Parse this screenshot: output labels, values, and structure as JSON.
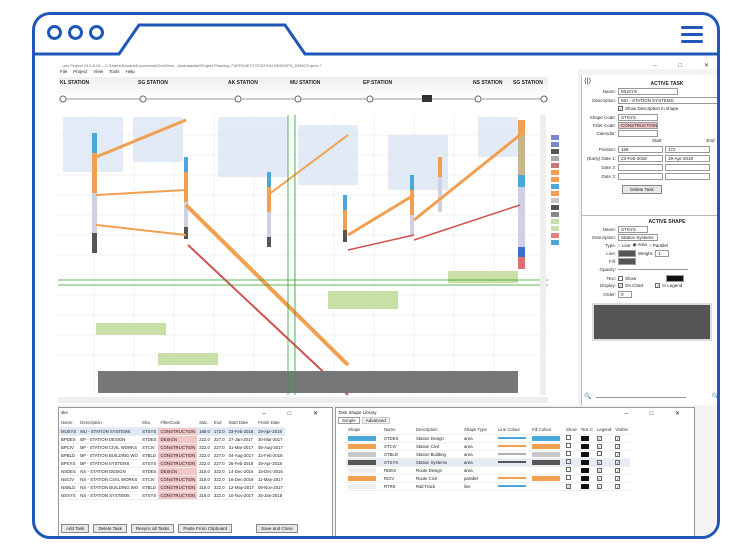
{
  "window": {
    "title": "...ear Project v3.0.8.15 -- C:\\Users\\Sandra\\Documents\\OneDrive - Australasian\\Project Planning 71\\PROJECT\\STATION DEMO\\PS_DEMO3.tpmz *",
    "menus": [
      "File",
      "Project",
      "View",
      "Tools",
      "Help"
    ]
  },
  "stations": [
    "KL STATION",
    "SG STATION",
    "AK STATION",
    "MU STATION",
    "EP STATION",
    "NS STATION",
    "SG STATION"
  ],
  "legend_items": [
    "",
    "",
    "",
    "",
    "",
    "",
    "",
    "",
    "",
    "",
    "",
    "",
    "",
    "",
    "",
    ""
  ],
  "active_task": {
    "title": "ACTIVE TASK",
    "name_label": "Name:",
    "name": "MUSYS",
    "desc_label": "Description:",
    "desc": "MU - STATION SYSTEMS",
    "show_desc": "Show Description in shape",
    "shape_code_label": "Shape Code:",
    "shape_code": "STSYS",
    "filter_code_label": "Filter Code:",
    "filter_code": "CONSTRUCTION",
    "calendar_label": "Calendar:",
    "start_label": "Start",
    "end_label": "End",
    "position_label": "Position:",
    "position_start": "168",
    "position_end": "172",
    "early_date_label": "(Early) Date 1:",
    "date1_start": "23-Feb-2018",
    "date1_end": "19-Apr-2018",
    "date2_label": "Date 2:",
    "date3_label": "Date 3:",
    "delete_btn": "Delete Task"
  },
  "active_shape": {
    "title": "ACTIVE SHAPE",
    "name_label": "Name:",
    "name": "STSYS",
    "desc_label": "Description:",
    "desc": "Station Systems",
    "type_label": "Type:",
    "type_line": "Line",
    "type_area": "Area",
    "type_parallel": "Parallel",
    "line_label": "Line:",
    "weight_label": "Weight:",
    "weight": "1",
    "fill_label": "Fill:",
    "opacity_label": "Opacity:",
    "text_label": "Text:",
    "show_label": "Show",
    "display_label": "Display:",
    "on_chart": "On Chart",
    "in_legend": "In Legend",
    "order_label": "Order:",
    "order": "0"
  },
  "tasks_window": {
    "title": "sks",
    "columns": [
      "Name",
      "Description",
      "Sha.",
      "FilterCode",
      "Star.",
      "End",
      "Start Date",
      "Finish Date"
    ],
    "rows": [
      [
        "MUSYS",
        "MU - STATION SYSTEMS",
        "STSYS",
        "CONSTRUCTION",
        "168.0",
        "172.0",
        "23-Feb-2018",
        "19-Apr-2018"
      ],
      [
        "BPDES",
        "BP - STATION DESIGN",
        "STDES",
        "DESIGN",
        "222.0",
        "227.0",
        "27-Jan-2017",
        "30-Mar-2017"
      ],
      [
        "BPCIV",
        "BP - STATION CIVIL WORKS",
        "STCIV",
        "CONSTRUCTION",
        "222.0",
        "227.0",
        "31-Mar-2017",
        "05-Aug-2017"
      ],
      [
        "BPBLD",
        "BP - STATION BUILDING WO",
        "STBLD",
        "CONSTRUCTION",
        "222.0",
        "227.0",
        "04-Aug-2017",
        "22-Feb-2018"
      ],
      [
        "BPSYS",
        "BP - STATION SYSTEMS",
        "STSYS",
        "CONSTRUCTION",
        "222.0",
        "227.0",
        "26-Feb-2018",
        "19-Apr-2018"
      ],
      [
        "NSDES",
        "NS - STATION DESIGN",
        "STDES",
        "DESIGN",
        "318.0",
        "322.0",
        "14-Dec-2016",
        "15-Dec-2016"
      ],
      [
        "NSCIV",
        "NS - STATION CIVIL WORKS",
        "STCIV",
        "CONSTRUCTION",
        "318.0",
        "322.0",
        "16-Dec-2016",
        "11-May-2017"
      ],
      [
        "NSBLD",
        "NS - STATION BUILDING WO",
        "STBLD",
        "CONSTRUCTION",
        "318.0",
        "322.0",
        "12-May-2017",
        "09-Nov-2017"
      ],
      [
        "NSSYS",
        "NS - STATION SYSTEMS",
        "STSYS",
        "CONSTRUCTION",
        "318.0",
        "322.0",
        "10-Nov-2017",
        "25-Jan-2018"
      ]
    ],
    "buttons": [
      "Add Task",
      "Delete Task",
      "Resync all Tasks",
      "Paste From Clipboard",
      "Save and Close"
    ]
  },
  "library_window": {
    "title": "Task Shape Library",
    "tabs": [
      "Simple",
      "Advanced"
    ],
    "columns": [
      "Shape",
      "Name",
      "Description",
      "Shape Type",
      "Line Colour",
      "Fill Colour",
      "Show",
      "Text C",
      "Legend",
      "Visible"
    ],
    "rows": [
      {
        "name": "STDES",
        "desc": "Station Design",
        "type": "area",
        "line": "#4aa8d8",
        "fill": "#4aa8d8",
        "show": false,
        "legend": true,
        "visible": true
      },
      {
        "name": "STCIV",
        "desc": "Station Civil",
        "type": "area",
        "line": "#f0a050",
        "fill": "#f0a050",
        "show": false,
        "legend": true,
        "visible": true
      },
      {
        "name": "STBLD",
        "desc": "Station Building",
        "type": "area",
        "line": "#b0b0b0",
        "fill": "#c8c8c8",
        "show": false,
        "legend": false,
        "visible": true
      },
      {
        "name": "STSYS",
        "desc": "Station Systems",
        "type": "area",
        "line": "#555555",
        "fill": "#555555",
        "show": false,
        "legend": true,
        "visible": true
      },
      {
        "name": "RDES",
        "desc": "Route Design",
        "type": "area",
        "line": "",
        "fill": "",
        "show": false,
        "legend": true,
        "visible": true
      },
      {
        "name": "RCIV",
        "desc": "Route Civil",
        "type": "parallel",
        "line": "#f0a050",
        "fill": "#f0a050",
        "show": false,
        "legend": true,
        "visible": true
      },
      {
        "name": "RTRK",
        "desc": "Rail Track",
        "type": "line",
        "line": "#4aa8d8",
        "fill": "",
        "show": true,
        "legend": true,
        "visible": true
      }
    ]
  },
  "colors": {
    "frame": "#1f56b8",
    "design": "#4aa8d8",
    "civil": "#f0a050",
    "building": "#c8c8e0",
    "systems": "#555555",
    "route": "#c8e0a8",
    "rail": "#d05050",
    "filter_pink": "#f4c7c7"
  }
}
